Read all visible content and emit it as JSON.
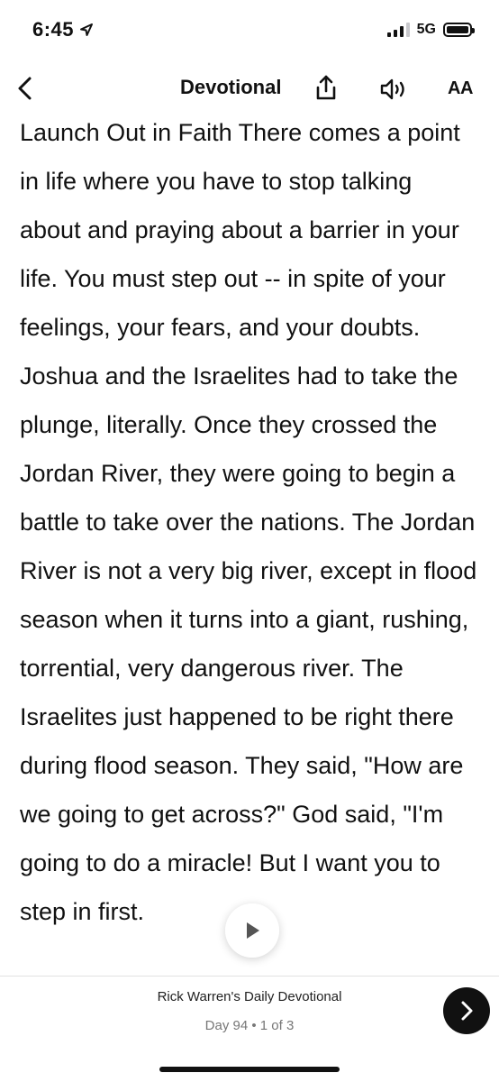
{
  "status_bar": {
    "time": "6:45",
    "network": "5G",
    "location_icon": "location-arrow-icon",
    "signal_bars_filled": 3,
    "signal_bars_total": 4,
    "battery_level": 1.0
  },
  "header": {
    "title": "Devotional",
    "text_size_label": "AA",
    "icons": {
      "back": "chevron-left-icon",
      "share": "share-icon",
      "audio": "speaker-icon"
    }
  },
  "content": {
    "text": "Launch Out in Faith There comes a point in life where you have to stop talking about and praying about a barrier in your life. You must step out -- in spite of your feelings, your fears, and your doubts. Joshua and the Israelites had to take the plunge, literally. Once they crossed the Jordan River, they were going to begin a battle to take over the nations. The Jordan River is not a very big river, except in flood season when it turns into a giant, rushing, torrential, very dangerous river. The Israelites just happened to be right there during flood season. They said, \"How are we going to get across?\" God said, \"I'm going to do a miracle! But I want you to step in first."
  },
  "player": {
    "play_icon": "play-icon"
  },
  "footer": {
    "source": "Rick Warren's Daily Devotional",
    "day_info": "Day 94 • 1 of 3",
    "next_icon": "chevron-right-icon"
  },
  "colors": {
    "text": "#111111",
    "muted": "#777777",
    "background": "#ffffff"
  }
}
